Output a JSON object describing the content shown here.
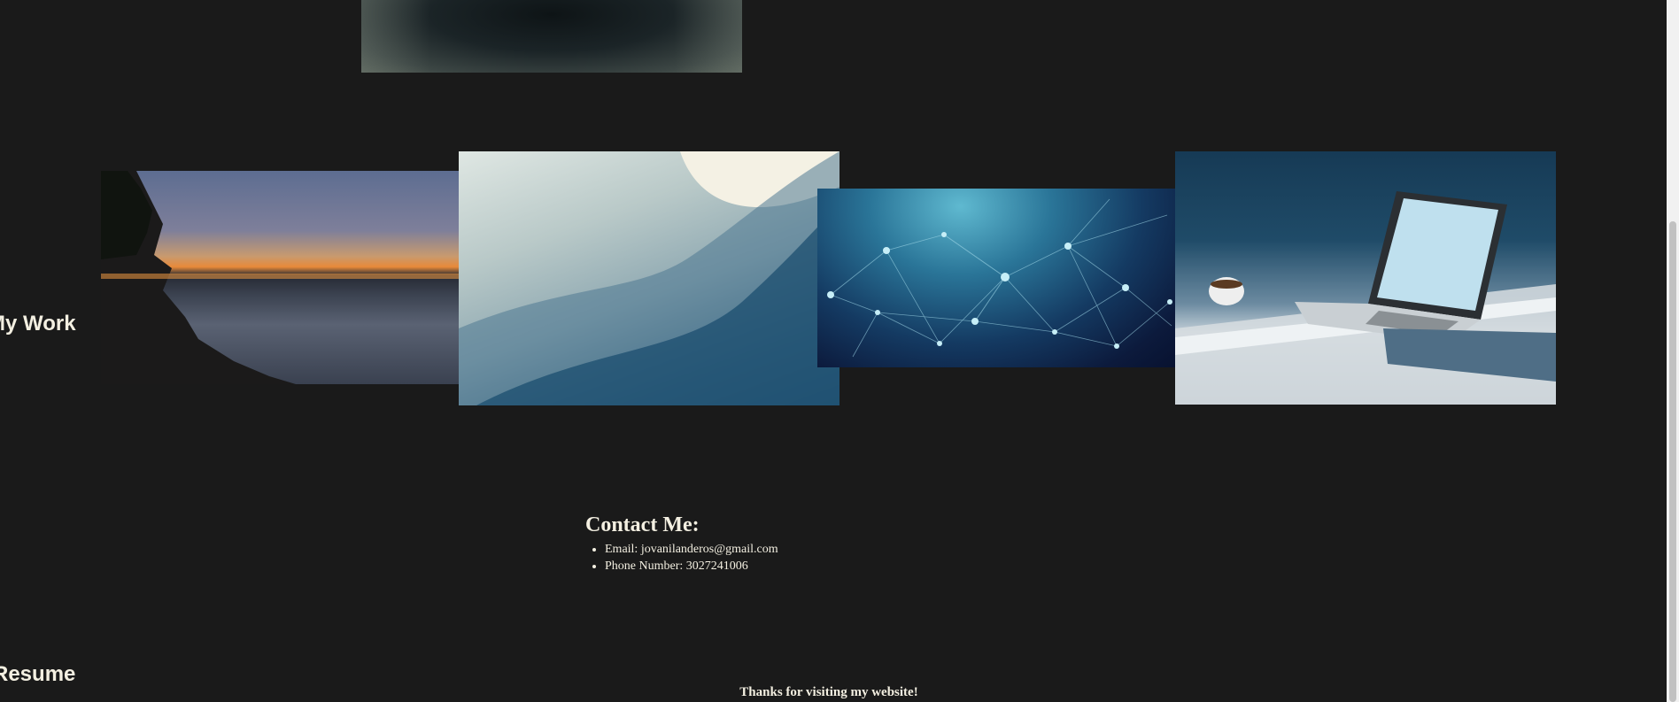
{
  "sections": {
    "work_heading": "My Work",
    "resume_heading": "Resume"
  },
  "contact": {
    "title": "Contact Me:",
    "items": [
      "Email: jovanilanderos@gmail.com",
      "Phone Number: 3027241006"
    ]
  },
  "footer": {
    "text": "Thanks for visiting my website!"
  }
}
